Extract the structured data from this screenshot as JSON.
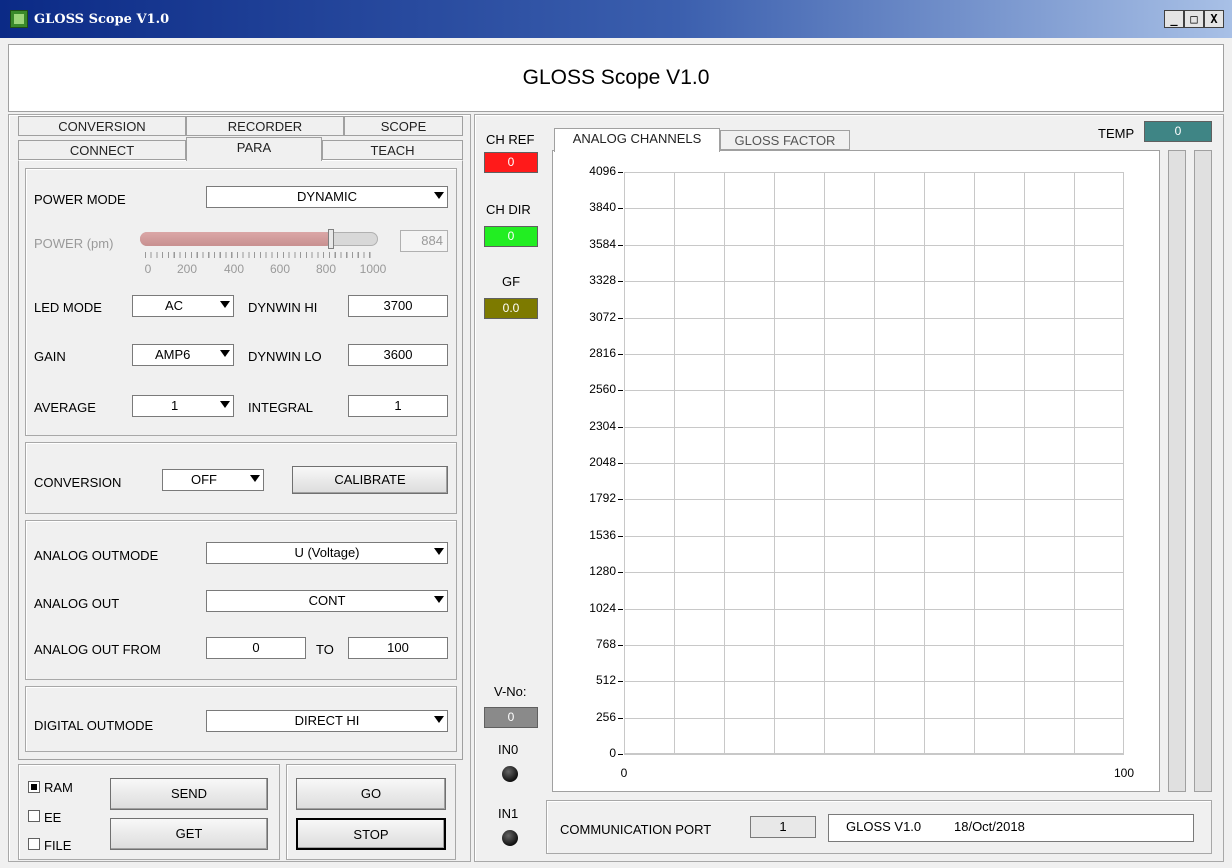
{
  "window": {
    "title": "GLOSS Scope V1.0",
    "min": "_",
    "max": "□",
    "close": "X"
  },
  "header": {
    "title": "GLOSS Scope V1.0"
  },
  "tabs_top": [
    "CONVERSION",
    "RECORDER",
    "SCOPE"
  ],
  "tabs_bottom": [
    "CONNECT",
    "PARA",
    "TEACH"
  ],
  "params": {
    "power_mode_label": "POWER MODE",
    "power_mode_value": "DYNAMIC",
    "power_label": "POWER (pm)",
    "power_value": "884",
    "power_fraction": 0.884,
    "power_ticks": [
      "0",
      "200",
      "400",
      "600",
      "800",
      "1000"
    ],
    "led_mode_label": "LED MODE",
    "led_mode_value": "AC",
    "dynwin_hi_label": "DYNWIN HI",
    "dynwin_hi_value": "3700",
    "gain_label": "GAIN",
    "gain_value": "AMP6",
    "dynwin_lo_label": "DYNWIN LO",
    "dynwin_lo_value": "3600",
    "average_label": "AVERAGE",
    "average_value": "1",
    "integral_label": "INTEGRAL",
    "integral_value": "1"
  },
  "conversion": {
    "label": "CONVERSION",
    "value": "OFF",
    "calibrate": "CALIBRATE"
  },
  "analog": {
    "outmode_label": "ANALOG OUTMODE",
    "outmode_value": "U (Voltage)",
    "out_label": "ANALOG OUT",
    "out_value": "CONT",
    "from_label": "ANALOG OUT FROM",
    "from_value": "0",
    "to_label": "TO",
    "to_value": "100"
  },
  "digital": {
    "label": "DIGITAL OUTMODE",
    "value": "DIRECT HI"
  },
  "memory": {
    "ram": "RAM",
    "ee": "EE",
    "file": "FILE",
    "send": "SEND",
    "get": "GET",
    "go": "GO",
    "stop": "STOP"
  },
  "indicators": {
    "ch_ref_label": "CH REF",
    "ch_ref_value": "0",
    "ch_ref_color": "#ff1a1a",
    "ch_dir_label": "CH DIR",
    "ch_dir_value": "0",
    "ch_dir_color": "#22ee22",
    "gf_label": "GF",
    "gf_value": "0.0",
    "gf_color": "#7d7a00",
    "vno_label": "V-No:",
    "vno_value": "0",
    "in0_label": "IN0",
    "in1_label": "IN1"
  },
  "graph_tabs": [
    "ANALOG CHANNELS",
    "GLOSS FACTOR"
  ],
  "temp": {
    "label": "TEMP",
    "value": "0",
    "color": "#3f8585"
  },
  "chart_data": {
    "type": "line",
    "y_ticks": [
      "4096",
      "3840",
      "3584",
      "3328",
      "3072",
      "2816",
      "2560",
      "2304",
      "2048",
      "1792",
      "1536",
      "1280",
      "1024",
      "768",
      "512",
      "256",
      "0"
    ],
    "x_ticks": [
      "0",
      "100"
    ],
    "ylim": [
      0,
      4096
    ],
    "xlim": [
      0,
      100
    ],
    "series": [],
    "grid": true
  },
  "comm": {
    "label": "COMMUNICATION PORT",
    "port": "1",
    "version": "GLOSS V1.0",
    "date": "18/Oct/2018"
  }
}
